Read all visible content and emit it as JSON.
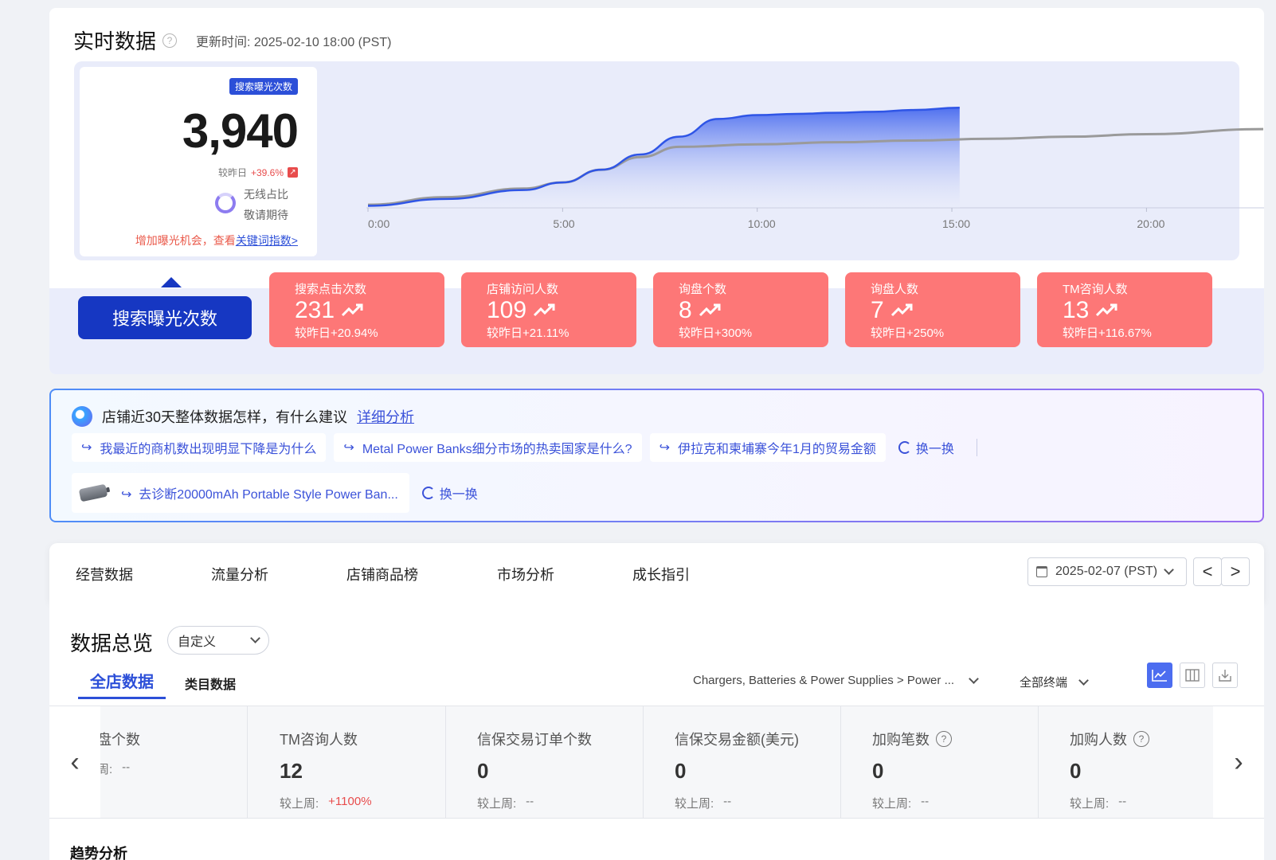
{
  "realtime": {
    "title": "实时数据",
    "help_icon": "?",
    "update_time": "更新时间: 2025-02-10 18:00 (PST)",
    "metric_tag": "搜索曝光次数",
    "metric_value": "3,940",
    "compare_label": "较昨日",
    "compare_value": "+39.6%",
    "compare_icon": "↗",
    "wireless_label": "无线占比",
    "wireless_value": "敬请期待",
    "tip_text": "增加曝光机会，查看",
    "tip_link": "关键词指数>"
  },
  "chart_data": {
    "type": "area",
    "x_ticks": [
      "0:00",
      "5:00",
      "10:00",
      "15:00",
      "20:00"
    ],
    "x_range": [
      0,
      23
    ],
    "y_range": [
      0,
      4200
    ],
    "series": [
      {
        "x": [
          0,
          2,
          4,
          5,
          6,
          7,
          8,
          9,
          10,
          11,
          12,
          13,
          14,
          15.2
        ],
        "values": [
          80,
          350,
          700,
          1000,
          1500,
          2100,
          2800,
          3500,
          3650,
          3700,
          3740,
          3780,
          3850,
          3940
        ]
      },
      {
        "x": [
          0,
          2,
          4,
          5,
          6,
          7,
          8,
          10,
          12,
          14,
          16,
          18,
          20,
          23
        ],
        "values": [
          120,
          420,
          760,
          1000,
          1500,
          2000,
          2400,
          2500,
          2580,
          2650,
          2720,
          2800,
          2900,
          3100
        ]
      }
    ],
    "colors": {
      "today": "#2f55e6",
      "yesterday": "#9a9a9a"
    }
  },
  "metric_tabs": {
    "active": "搜索曝光次数",
    "kpis": [
      {
        "label": "搜索点击次数",
        "value": "231",
        "compare": "较昨日+20.94%"
      },
      {
        "label": "店铺访问人数",
        "value": "109",
        "compare": "较昨日+21.11%"
      },
      {
        "label": "询盘个数",
        "value": "8",
        "compare": "较昨日+300%"
      },
      {
        "label": "询盘人数",
        "value": "7",
        "compare": "较昨日+250%"
      },
      {
        "label": "TM咨询人数",
        "value": "13",
        "compare": "较昨日+116.67%"
      }
    ]
  },
  "ai": {
    "question": "店铺近30天整体数据怎样，有什么建议",
    "detail_link": "详细分析",
    "suggestions": [
      "我最近的商机数出现明显下降是为什么",
      "Metal Power Banks细分市场的热卖国家是什么?",
      "伊拉克和柬埔寨今年1月的贸易金额"
    ],
    "swap_label": "换一换",
    "product_prompt": "去诊断20000mAh Portable Style Power Ban...",
    "return_icon": "↪"
  },
  "nav": {
    "items": [
      "经营数据",
      "流量分析",
      "店铺商品榜",
      "市场分析",
      "成长指引"
    ],
    "date": "2025-02-07 (PST)",
    "prev": "<",
    "next": ">"
  },
  "overview": {
    "title": "数据总览",
    "range_select": "自定义",
    "tab_active": "全店数据",
    "tab_other": "类目数据",
    "category": "Chargers, Batteries & Power Supplies > Power ...",
    "terminal": "全部终端",
    "left_arrow": "‹",
    "right_arrow": "›",
    "stats": [
      {
        "label": "盘个数",
        "value": "",
        "compare_label": "周:",
        "compare_value": "--"
      },
      {
        "label": "TM咨询人数",
        "value": "12",
        "compare_label": "较上周:",
        "compare_value": "+1100%"
      },
      {
        "label": "信保交易订单个数",
        "value": "0",
        "compare_label": "较上周:",
        "compare_value": "--"
      },
      {
        "label": "信保交易金额(美元)",
        "value": "0",
        "compare_label": "较上周:",
        "compare_value": "--"
      },
      {
        "label": "加购笔数",
        "value": "0",
        "compare_label": "较上周:",
        "compare_value": "--"
      },
      {
        "label": "加购人数",
        "value": "0",
        "compare_label": "较上周:",
        "compare_value": "--"
      }
    ],
    "trend_title": "趋势分析"
  }
}
